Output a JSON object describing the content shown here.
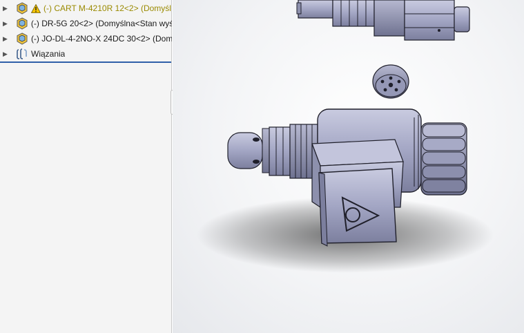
{
  "feature_tree": {
    "items": [
      {
        "label": "(-) CART M-4210R 12<2> (Domyśl",
        "icon": "part-assembly-icon",
        "warning": true
      },
      {
        "label": "(-) DR-5G 20<2> (Domyślna<Stan wyś",
        "icon": "part-assembly-icon",
        "warning": false
      },
      {
        "label": "(-) JO-DL-4-2NO-X 24DC 30<2> (Dom",
        "icon": "part-assembly-icon",
        "warning": false
      },
      {
        "label": "Wiązania",
        "icon": "mates-icon",
        "warning": false
      }
    ]
  },
  "colors": {
    "warning_text": "#9a8a00",
    "separator": "#2f5fa8",
    "model_body": "#a3a6c4",
    "model_edge": "#1f1f2a"
  }
}
